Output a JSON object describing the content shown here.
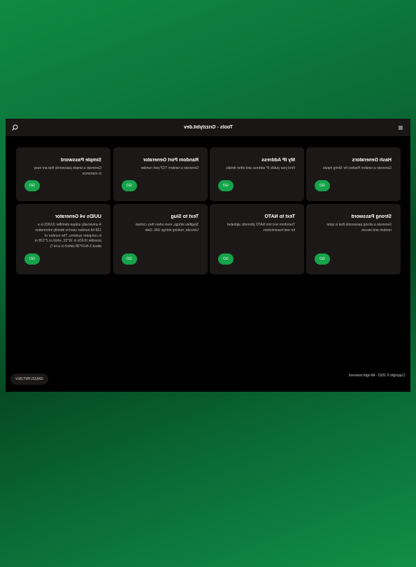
{
  "header": {
    "title": "Tools - Grizzlybit.dev",
    "search_icon": "search-icon",
    "menu_icon": "menu-icon"
  },
  "tools": [
    {
      "id": "hash-generators",
      "title": "Hash Generators",
      "description": "Generate a random Hashes for String inputs",
      "button": "GO"
    },
    {
      "id": "my-ip-address",
      "title": "My IP Address",
      "description": "Find your public IP address and other details",
      "button": "GO"
    },
    {
      "id": "random-port-generator",
      "title": "Random Port Generator",
      "description": "Generate a random TCP port number",
      "button": "GO"
    },
    {
      "id": "simple-password",
      "title": "Simple Password",
      "description": "Generate a simple passwords that are easy to memorize",
      "button": "GO"
    },
    {
      "id": "strong-password",
      "title": "Strong Password",
      "description": "Generate a strong passwords that is quite random and secure",
      "button": "GO"
    },
    {
      "id": "text-to-nato",
      "title": "Text to NATO",
      "description": "Transform text into NATO phonetic alphabet for oral transmission.",
      "button": "GO"
    },
    {
      "id": "text-to-slug",
      "title": "Text to Slug",
      "description": "Slugifies strings, even when they contain Unicode, making strings URL-Safe",
      "button": "GO"
    },
    {
      "id": "uuid-v4-generator",
      "title": "UUIDs v4 Generator",
      "description": "A universally unique identifier (UUID) is a 128-bit number used to identify information in computer systems. The number of possible UUIDs is 16^32, which is 2^128 or about 3.4x10^38 (which is a lot !).",
      "button": "GO"
    }
  ],
  "footer": {
    "copyright": "Copyright © 2023 - All right reserved",
    "brand": "GRIZZLYBIT.DEV"
  },
  "colors": {
    "accent": "#16a34a",
    "card": "#1c1818",
    "topbar": "#1a1616",
    "window": "#000000"
  }
}
